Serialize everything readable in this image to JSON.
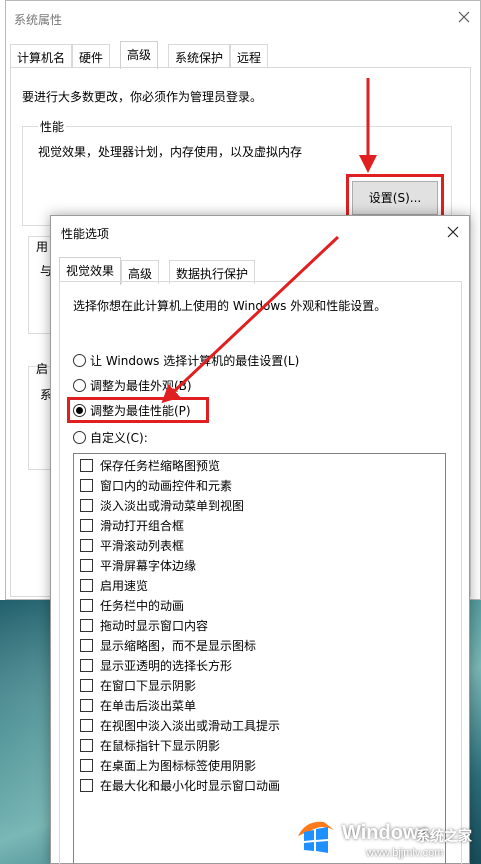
{
  "back_window": {
    "title": "系统属性",
    "tabs": [
      {
        "label": "计算机名"
      },
      {
        "label": "硬件"
      },
      {
        "label": "高级"
      },
      {
        "label": "系统保护"
      },
      {
        "label": "远程"
      }
    ],
    "admin_note": "要进行大多数更改，你必须作为管理员登录。",
    "performance": {
      "group_label": "性能",
      "description": "视觉效果，处理器计划，内存使用，以及虚拟内存",
      "settings_button": "设置(S)..."
    },
    "group2_label": "用",
    "group2_sub": "与",
    "group3_label": "启",
    "group3_sub": "系"
  },
  "front_window": {
    "title": "性能选项",
    "tabs": [
      {
        "label": "视觉效果"
      },
      {
        "label": "高级"
      },
      {
        "label": "数据执行保护"
      }
    ],
    "instruction": "选择你想在此计算机上使用的 Windows 外观和性能设置。",
    "radios": [
      {
        "label": "让 Windows 选择计算机的最佳设置(L)",
        "checked": false
      },
      {
        "label": "调整为最佳外观(B)",
        "checked": false
      },
      {
        "label": "调整为最佳性能(P)",
        "checked": true
      },
      {
        "label": "自定义(C):",
        "checked": false
      }
    ],
    "effects": [
      {
        "label": "保存任务栏缩略图预览",
        "checked": false
      },
      {
        "label": "窗口内的动画控件和元素",
        "checked": false
      },
      {
        "label": "淡入淡出或滑动菜单到视图",
        "checked": false
      },
      {
        "label": "滑动打开组合框",
        "checked": false
      },
      {
        "label": "平滑滚动列表框",
        "checked": false
      },
      {
        "label": "平滑屏幕字体边缘",
        "checked": false
      },
      {
        "label": "启用速览",
        "checked": false
      },
      {
        "label": "任务栏中的动画",
        "checked": false
      },
      {
        "label": "拖动时显示窗口内容",
        "checked": false
      },
      {
        "label": "显示缩略图，而不是显示图标",
        "checked": false
      },
      {
        "label": "显示亚透明的选择长方形",
        "checked": false
      },
      {
        "label": "在窗口下显示阴影",
        "checked": false
      },
      {
        "label": "在单击后淡出菜单",
        "checked": false
      },
      {
        "label": "在视图中淡入淡出或滑动工具提示",
        "checked": false
      },
      {
        "label": "在鼠标指针下显示阴影",
        "checked": false
      },
      {
        "label": "在桌面上为图标标签使用阴影",
        "checked": false
      },
      {
        "label": "在最大化和最小化时显示窗口动画",
        "checked": false
      }
    ]
  },
  "watermark": {
    "brand": "Windows",
    "brand_cn": "系统之家",
    "url": "www.bjjmlv.com"
  },
  "colors": {
    "highlight_red": "#e02020",
    "windows_logo_blue": "#1e90ff"
  }
}
